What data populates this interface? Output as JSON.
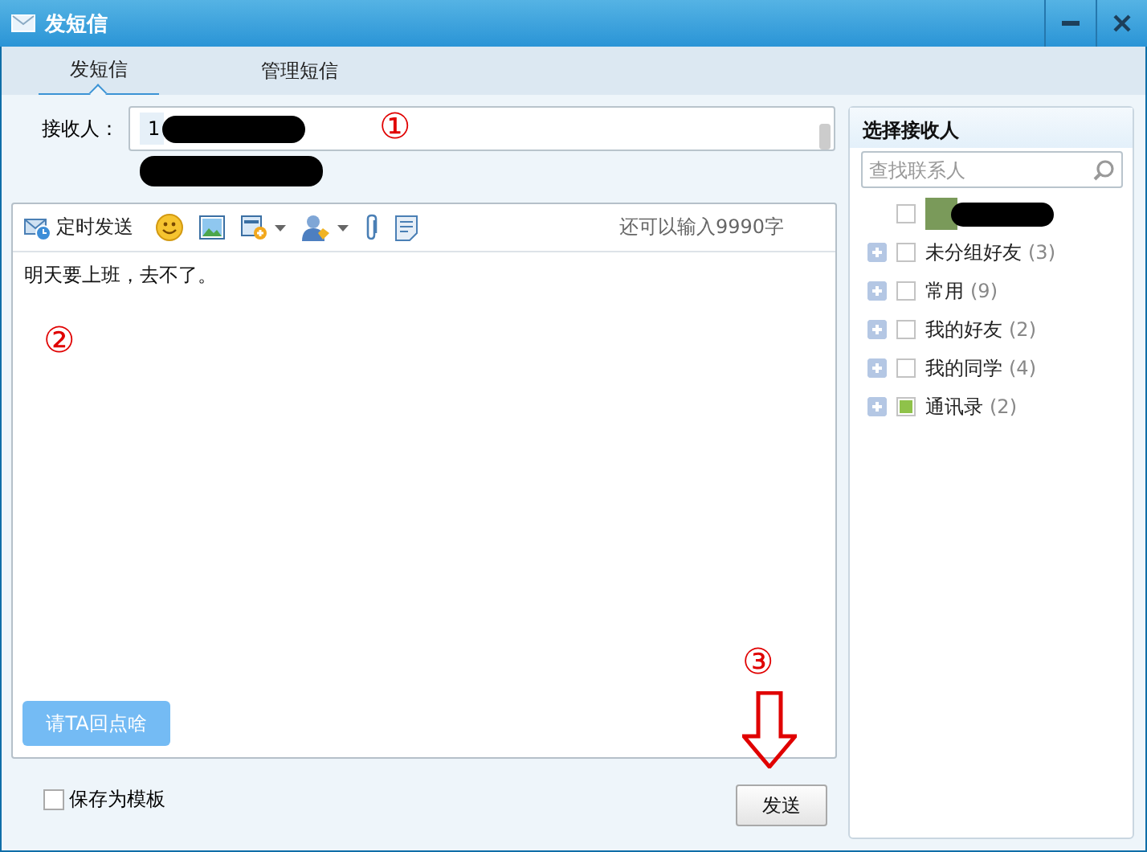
{
  "window": {
    "title": "发短信"
  },
  "tabs": [
    {
      "label": "发短信",
      "selected": true
    },
    {
      "label": "管理短信",
      "selected": false
    }
  ],
  "recipient": {
    "label": "接收人：",
    "value": "1"
  },
  "toolbar": {
    "schedule_label": "定时发送",
    "remaining": "还可以输入9990字"
  },
  "message": {
    "value": "明天要上班，去不了。"
  },
  "reply_prompt_button": "请TA回点啥",
  "save_template": {
    "label": "保存为模板",
    "checked": false
  },
  "send_button": "发送",
  "contacts": {
    "title": "选择接收人",
    "search": {
      "placeholder": "查找联系人"
    },
    "items": [
      {
        "kind": "contact",
        "checked": false
      },
      {
        "kind": "group",
        "name": "未分组好友",
        "count": "(3)",
        "checked": false,
        "partial": false,
        "expanded": false
      },
      {
        "kind": "group",
        "name": "常用",
        "count": "(9)",
        "checked": false,
        "partial": false,
        "expanded": false
      },
      {
        "kind": "group",
        "name": "我的好友",
        "count": "(2)",
        "checked": false,
        "partial": false,
        "expanded": false
      },
      {
        "kind": "group",
        "name": "我的同学",
        "count": "(4)",
        "checked": false,
        "partial": false,
        "expanded": false
      },
      {
        "kind": "group",
        "name": "通讯录",
        "count": "(2)",
        "checked": false,
        "partial": true,
        "expanded": false
      }
    ]
  },
  "annotations": [
    {
      "label": "①"
    },
    {
      "label": "②"
    },
    {
      "label": "③"
    }
  ]
}
